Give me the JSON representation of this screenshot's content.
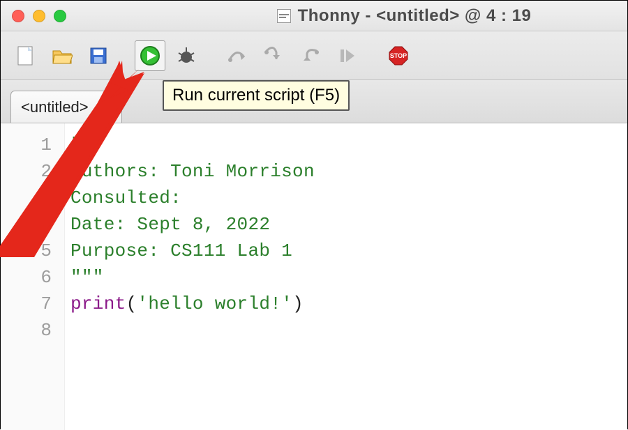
{
  "window": {
    "title": "Thonny  -  <untitled>  @  4 : 19"
  },
  "toolbar": {
    "tooltip_run": "Run current script (F5)"
  },
  "tab": {
    "label": "<untitled>",
    "close_glyph": "×"
  },
  "code": {
    "lines": [
      {
        "n": "1",
        "cls": "s-comment",
        "t": "\"\"\""
      },
      {
        "n": "2",
        "cls": "s-comment",
        "t": "Authors: Toni Morrison"
      },
      {
        "n": "3",
        "cls": "s-comment",
        "t": "Consulted:"
      },
      {
        "n": "4",
        "cls": "s-comment",
        "t": "Date: Sept 8, 2022"
      },
      {
        "n": "5",
        "cls": "s-comment",
        "t": "Purpose: CS111 Lab 1"
      },
      {
        "n": "6",
        "cls": "s-comment",
        "t": "\"\"\""
      },
      {
        "n": "7",
        "cls": "s-plain",
        "t": ""
      },
      {
        "n": "8",
        "cls": "mixed",
        "t": ""
      }
    ],
    "line8": {
      "func": "print",
      "paren_open": "(",
      "str": "'hello world!'",
      "paren_close": ")"
    }
  }
}
